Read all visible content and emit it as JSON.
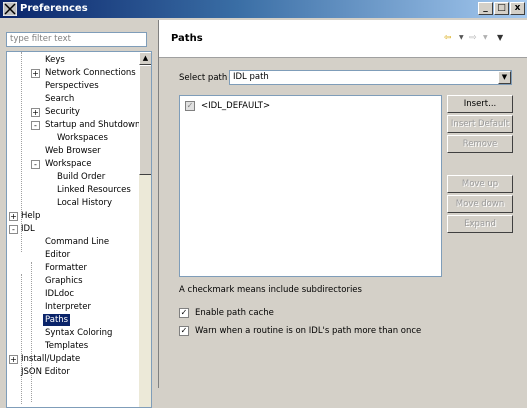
{
  "window": {
    "title": "Preferences",
    "controls": {
      "minimize": "_",
      "maximize": "□",
      "close": "x"
    }
  },
  "sidebar": {
    "filter_placeholder": "type filter text",
    "tree": [
      {
        "label": "Keys",
        "expander": ""
      },
      {
        "label": "Network Connections",
        "expander": "+"
      },
      {
        "label": "Perspectives",
        "expander": ""
      },
      {
        "label": "Search",
        "expander": ""
      },
      {
        "label": "Security",
        "expander": "+"
      },
      {
        "label": "Startup and Shutdown",
        "expander": "-"
      },
      {
        "label": "Workspaces",
        "expander": ""
      },
      {
        "label": "Web Browser",
        "expander": ""
      },
      {
        "label": "Workspace",
        "expander": "-"
      },
      {
        "label": "Build Order",
        "expander": ""
      },
      {
        "label": "Linked Resources",
        "expander": ""
      },
      {
        "label": "Local History",
        "expander": ""
      },
      {
        "label": "Help",
        "expander": "+"
      },
      {
        "label": "IDL",
        "expander": "-"
      },
      {
        "label": "Command Line",
        "expander": ""
      },
      {
        "label": "Editor",
        "expander": ""
      },
      {
        "label": "Formatter",
        "expander": ""
      },
      {
        "label": "Graphics",
        "expander": ""
      },
      {
        "label": "IDLdoc",
        "expander": ""
      },
      {
        "label": "Interpreter",
        "expander": ""
      },
      {
        "label": "Paths",
        "expander": "",
        "selected": true
      },
      {
        "label": "Syntax Coloring",
        "expander": ""
      },
      {
        "label": "Templates",
        "expander": ""
      },
      {
        "label": "Install/Update",
        "expander": "+"
      },
      {
        "label": "JSON Editor",
        "expander": ""
      }
    ]
  },
  "main": {
    "page_title": "Paths",
    "nav": {
      "back_icon": "back-arrow-icon",
      "forward_icon": "forward-arrow-icon",
      "menu_icon": "view-menu-icon"
    },
    "select_path_label": "Select path",
    "select_path_value": "IDL path",
    "paths": [
      {
        "text": "<IDL_DEFAULT>",
        "checked": true
      }
    ],
    "buttons": {
      "insert": "Insert...",
      "insert_default": "Insert Default",
      "remove": "Remove",
      "move_up": "Move up",
      "move_down": "Move down",
      "expand": "Expand"
    },
    "hint": "A checkmark means include subdirectories",
    "options": [
      {
        "label": "Enable path cache",
        "checked": true
      },
      {
        "label": "Warn when a routine is on IDL's path more than once",
        "checked": true
      }
    ]
  }
}
